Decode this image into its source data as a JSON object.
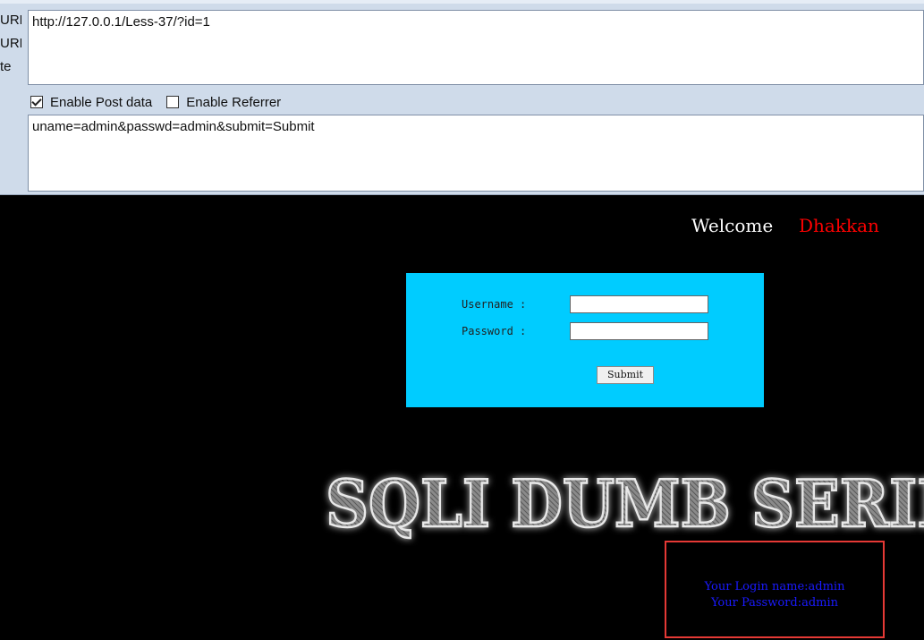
{
  "hackbar": {
    "side_labels": [
      "URL",
      "URL",
      "te"
    ],
    "url_value": "http://127.0.0.1/Less-37/?id=1",
    "options": {
      "post_label": "Enable Post data",
      "post_checked": true,
      "referrer_label": "Enable Referrer",
      "referrer_checked": false
    },
    "post_value": "uname=admin&passwd=admin&submit=Submit"
  },
  "page": {
    "welcome_label": "Welcome",
    "welcome_name": "Dhakkan",
    "form": {
      "username_label": "Username :",
      "password_label": "Password :",
      "submit_label": "Submit"
    },
    "banner_text": "SQLI DUMB SERIES",
    "result": {
      "login_name": "Your Login name:admin",
      "password": "Your Password:admin"
    }
  },
  "colors": {
    "page_bg": "#000000",
    "panel_bg": "#00ccff",
    "welcome_name": "#ff0000",
    "result_text": "#1a1aff",
    "highlight_border": "#e53935",
    "hackbar_bg": "#cfdbea"
  }
}
